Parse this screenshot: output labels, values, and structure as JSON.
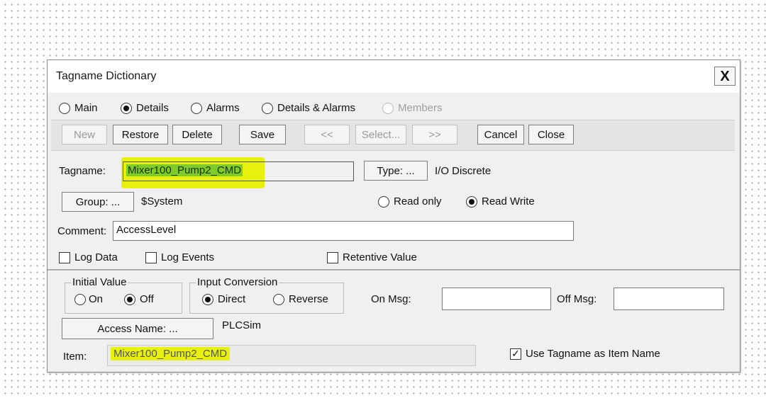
{
  "dialog": {
    "title": "Tagname Dictionary",
    "close_label": "X"
  },
  "view_modes": [
    {
      "label": "Main",
      "selected": false
    },
    {
      "label": "Details",
      "selected": true
    },
    {
      "label": "Alarms",
      "selected": false
    },
    {
      "label": "Details & Alarms",
      "selected": false
    },
    {
      "label": "Members",
      "selected": false,
      "disabled": true
    }
  ],
  "toolbar": {
    "new_label": "New",
    "restore_label": "Restore",
    "delete_label": "Delete",
    "save_label": "Save",
    "prev_label": "<<",
    "select_label": "Select...",
    "next_label": ">>",
    "cancel_label": "Cancel",
    "close_label": "Close"
  },
  "tag": {
    "tagname_label": "Tagname:",
    "tagname_value": "Mixer100_Pump2_CMD",
    "type_button": "Type: ...",
    "type_value": "I/O Discrete",
    "group_button": "Group: ...",
    "group_value": "$System",
    "read_only_label": "Read only",
    "read_write_label": "Read Write",
    "access_mode": "Read Write",
    "comment_label": "Comment:",
    "comment_value": "AccessLevel",
    "log_data_label": "Log Data",
    "log_events_label": "Log Events",
    "retentive_label": "Retentive Value"
  },
  "details": {
    "initial_value_title": "Initial Value",
    "on_label": "On",
    "off_label": "Off",
    "initial_value": "Off",
    "input_conversion_title": "Input Conversion",
    "direct_label": "Direct",
    "reverse_label": "Reverse",
    "input_conversion": "Direct",
    "on_msg_label": "On Msg:",
    "on_msg_value": "",
    "off_msg_label": "Off Msg:",
    "off_msg_value": "",
    "access_name_button": "Access Name: ...",
    "access_name_value": "PLCSim",
    "item_label": "Item:",
    "item_value": "Mixer100_Pump2_CMD",
    "use_tagname_label": "Use Tagname as Item Name",
    "use_tagname_checked": true
  },
  "colors": {
    "highlight": "#e8f00e",
    "titlebar": "#ffffff",
    "dialog_bg": "#f0f0f0"
  }
}
